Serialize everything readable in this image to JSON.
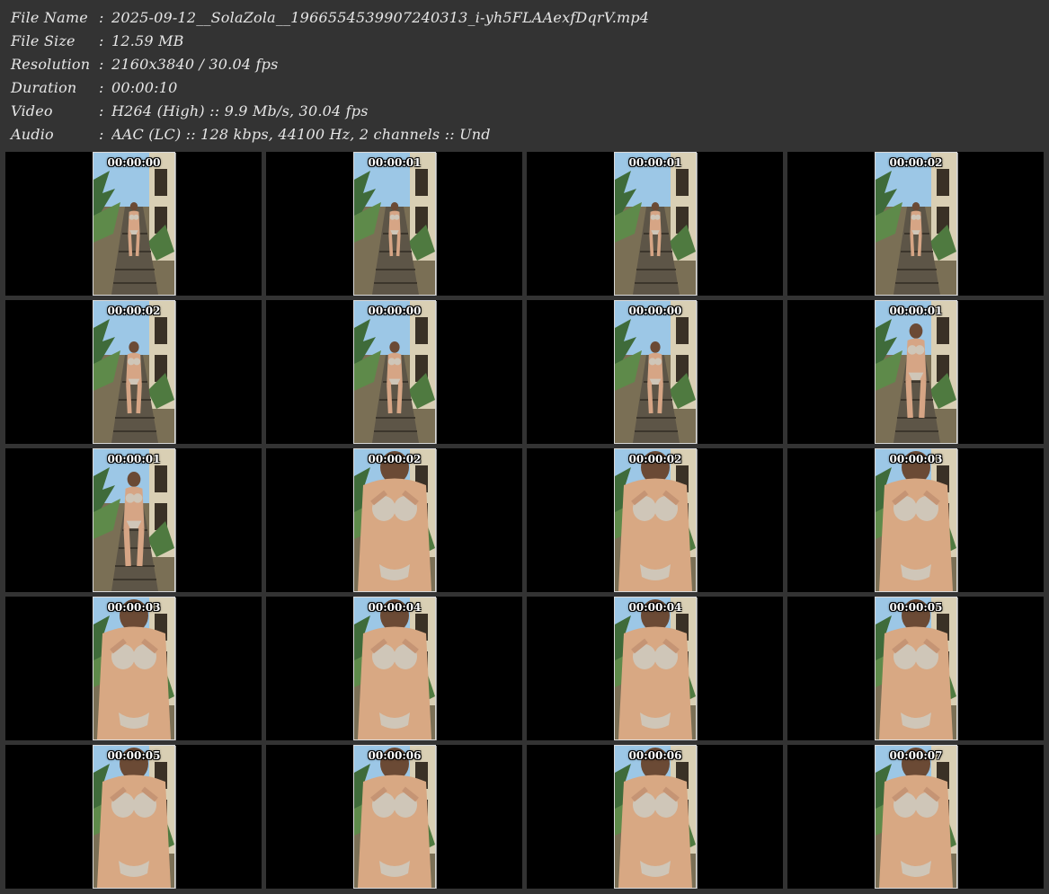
{
  "info": [
    {
      "label": "File Name",
      "sep": ":",
      "value": "2025-09-12__SolaZola__1966554539907240313_i-yh5FLAAexfDqrV.mp4"
    },
    {
      "label": "File Size",
      "sep": ":",
      "value": "12.59 MB"
    },
    {
      "label": "Resolution",
      "sep": ":",
      "value": "2160x3840 / 30.04 fps"
    },
    {
      "label": "Duration",
      "sep": ":",
      "value": "00:00:10"
    },
    {
      "label": "Video",
      "sep": ":",
      "value": "H264 (High) :: 9.9 Mb/s, 30.04 fps"
    },
    {
      "label": "Audio",
      "sep": ":",
      "value": "AAC (LC) :: 128 kbps, 44100 Hz, 2 channels :: Und"
    }
  ],
  "colors": {
    "background": "#333333",
    "cell": "#000000",
    "text": "#e6e6e6",
    "frame_border": "#d9d9d9"
  },
  "thumbnails": [
    {
      "timestamp": "00:00:00",
      "scene": "walkway-far"
    },
    {
      "timestamp": "00:00:01",
      "scene": "walkway-far"
    },
    {
      "timestamp": "00:00:01",
      "scene": "walkway-far"
    },
    {
      "timestamp": "00:00:02",
      "scene": "walkway-far"
    },
    {
      "timestamp": "00:00:02",
      "scene": "walkway-mid"
    },
    {
      "timestamp": "00:00:00",
      "scene": "walkway-mid"
    },
    {
      "timestamp": "00:00:00",
      "scene": "walkway-mid"
    },
    {
      "timestamp": "00:00:01",
      "scene": "walkway-near"
    },
    {
      "timestamp": "00:00:01",
      "scene": "walkway-near"
    },
    {
      "timestamp": "00:00:02",
      "scene": "closeup"
    },
    {
      "timestamp": "00:00:02",
      "scene": "closeup"
    },
    {
      "timestamp": "00:00:03",
      "scene": "closeup"
    },
    {
      "timestamp": "00:00:03",
      "scene": "closeup"
    },
    {
      "timestamp": "00:00:04",
      "scene": "closeup"
    },
    {
      "timestamp": "00:00:04",
      "scene": "closeup"
    },
    {
      "timestamp": "00:00:05",
      "scene": "closeup"
    },
    {
      "timestamp": "00:00:05",
      "scene": "closeup"
    },
    {
      "timestamp": "00:00:06",
      "scene": "closeup"
    },
    {
      "timestamp": "00:00:06",
      "scene": "closeup"
    },
    {
      "timestamp": "00:00:07",
      "scene": "closeup"
    }
  ]
}
